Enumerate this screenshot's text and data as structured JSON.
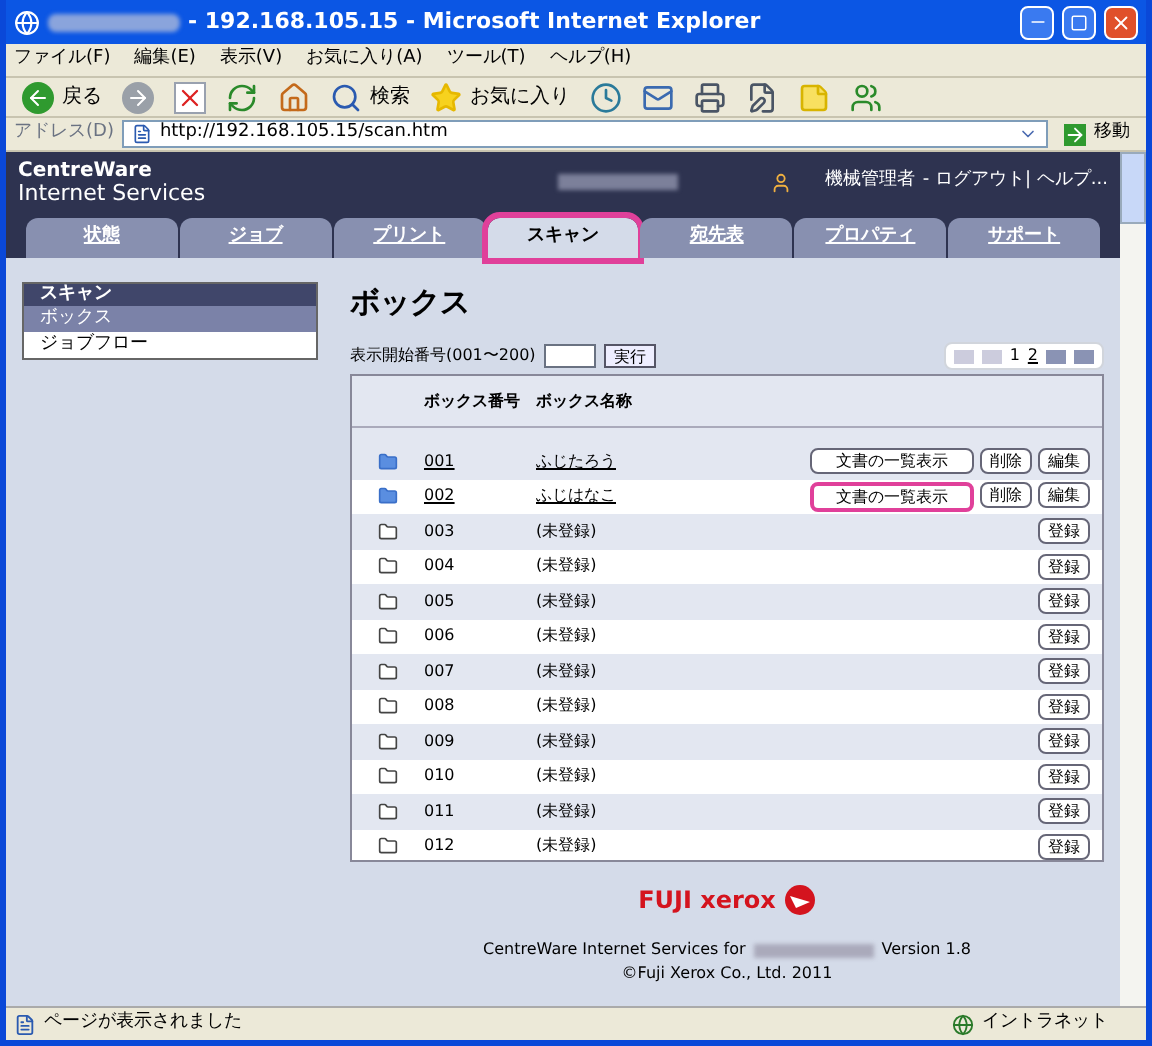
{
  "window": {
    "title": "- 192.168.105.15 - Microsoft Internet Explorer"
  },
  "menu": [
    "ファイル(F)",
    "編集(E)",
    "表示(V)",
    "お気に入り(A)",
    "ツール(T)",
    "ヘルプ(H)"
  ],
  "toolbar": [
    {
      "kind": "back",
      "label": "戻る"
    },
    {
      "kind": "forward"
    },
    {
      "kind": "stop"
    },
    {
      "kind": "refresh"
    },
    {
      "kind": "home"
    },
    {
      "kind": "search",
      "label": "検索"
    },
    {
      "kind": "favorites",
      "label": "お気に入り"
    },
    {
      "kind": "history"
    },
    {
      "kind": "mail"
    },
    {
      "kind": "print"
    },
    {
      "kind": "edit"
    },
    {
      "kind": "note"
    },
    {
      "kind": "messenger"
    }
  ],
  "address": {
    "label": "アドレス(D)",
    "value": "http://192.168.105.15/scan.htm",
    "go": "移動"
  },
  "app": {
    "brand_line1": "CentreWare",
    "brand_line2": "Internet Services",
    "user": "機械管理者",
    "links": "- ログアウト| ヘルプ..."
  },
  "tabs": [
    {
      "label": "状態",
      "selected": false,
      "highlighted": false
    },
    {
      "label": "ジョブ",
      "selected": false,
      "highlighted": false
    },
    {
      "label": "プリント",
      "selected": false,
      "highlighted": false
    },
    {
      "label": "スキャン",
      "selected": true,
      "highlighted": true
    },
    {
      "label": "宛先表",
      "selected": false,
      "highlighted": false
    },
    {
      "label": "プロパティ",
      "selected": false,
      "highlighted": false
    },
    {
      "label": "サポート",
      "selected": false,
      "highlighted": false
    }
  ],
  "sidebar": {
    "title": "スキャン",
    "items": [
      {
        "label": "ボックス",
        "selected": true
      },
      {
        "label": "ジョブフロー",
        "selected": false
      }
    ]
  },
  "heading": "ボックス",
  "start_number": {
    "label": "表示開始番号(001〜200)",
    "button": "実行"
  },
  "pagination": [
    {
      "label": "1",
      "selected": true
    },
    {
      "label": "2",
      "selected": false
    }
  ],
  "table": {
    "columns": [
      "ボックス番号",
      "ボックス名称"
    ],
    "rows": [
      {
        "number": "001",
        "name": "ふじたろう",
        "registered": true,
        "buttons": [
          {
            "label": "文書の一覧表示",
            "highlighted": false
          },
          {
            "label": "削除",
            "highlighted": false
          },
          {
            "label": "編集",
            "highlighted": false
          }
        ]
      },
      {
        "number": "002",
        "name": "ふじはなこ",
        "registered": true,
        "buttons": [
          {
            "label": "文書の一覧表示",
            "highlighted": true
          },
          {
            "label": "削除",
            "highlighted": false
          },
          {
            "label": "編集",
            "highlighted": false
          }
        ]
      },
      {
        "number": "003",
        "name": "(未登録)",
        "registered": false,
        "buttons": [
          {
            "label": "登録",
            "highlighted": false
          }
        ]
      },
      {
        "number": "004",
        "name": "(未登録)",
        "registered": false,
        "buttons": [
          {
            "label": "登録",
            "highlighted": false
          }
        ]
      },
      {
        "number": "005",
        "name": "(未登録)",
        "registered": false,
        "buttons": [
          {
            "label": "登録",
            "highlighted": false
          }
        ]
      },
      {
        "number": "006",
        "name": "(未登録)",
        "registered": false,
        "buttons": [
          {
            "label": "登録",
            "highlighted": false
          }
        ]
      },
      {
        "number": "007",
        "name": "(未登録)",
        "registered": false,
        "buttons": [
          {
            "label": "登録",
            "highlighted": false
          }
        ]
      },
      {
        "number": "008",
        "name": "(未登録)",
        "registered": false,
        "buttons": [
          {
            "label": "登録",
            "highlighted": false
          }
        ]
      },
      {
        "number": "009",
        "name": "(未登録)",
        "registered": false,
        "buttons": [
          {
            "label": "登録",
            "highlighted": false
          }
        ]
      },
      {
        "number": "010",
        "name": "(未登録)",
        "registered": false,
        "buttons": [
          {
            "label": "登録",
            "highlighted": false
          }
        ]
      },
      {
        "number": "011",
        "name": "(未登録)",
        "registered": false,
        "buttons": [
          {
            "label": "登録",
            "highlighted": false
          }
        ]
      },
      {
        "number": "012",
        "name": "(未登録)",
        "registered": false,
        "buttons": [
          {
            "label": "登録",
            "highlighted": false
          }
        ]
      }
    ]
  },
  "footer": {
    "logo": "FUJI xerox",
    "line1_start": "CentreWare Internet Services for",
    "line1_end": "Version 1.8",
    "line2": "©Fuji Xerox Co., Ltd. 2011"
  },
  "status_bar": {
    "message": "ページが表示されました",
    "zone": "イントラネット"
  }
}
